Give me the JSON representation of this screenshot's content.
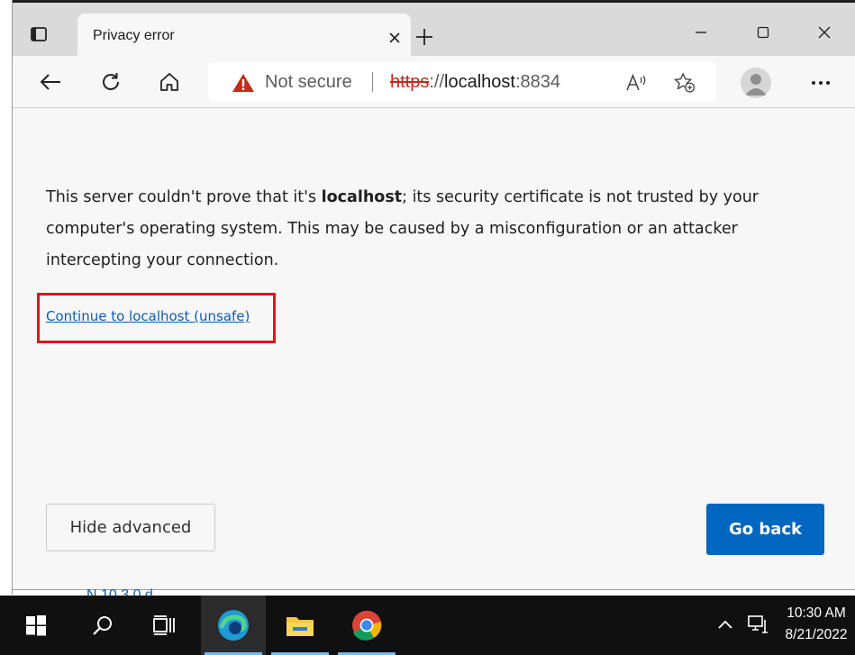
{
  "browser": {
    "tab": {
      "title": "Privacy error"
    },
    "address_bar": {
      "security_label": "Not secure",
      "url_scheme": "https",
      "url_separator": "://",
      "url_host": "localhost",
      "url_port": ":8834"
    }
  },
  "page": {
    "message_part1": "This server couldn't prove that it's ",
    "message_host": "localhost",
    "message_part2": "; its security certificate is not trusted by your computer's operating system. This may be caused by a misconfiguration or an attacker intercepting your connection.",
    "continue_link": "Continue to localhost (unsafe)",
    "hide_advanced_button": "Hide advanced",
    "go_back_button": "Go back"
  },
  "background_window": {
    "peek_text": "N   10.3.0 d"
  },
  "taskbar": {
    "clock_time": "10:30 AM",
    "clock_date": "8/21/2022",
    "pinned": [
      "start-icon",
      "search-icon",
      "task-view-icon",
      "edge-icon",
      "file-explorer-icon",
      "chrome-icon"
    ]
  },
  "colors": {
    "accent": "#0067c0",
    "warning": "#c42b1c",
    "highlight": "#e0141e",
    "link": "#0a5fb4"
  }
}
